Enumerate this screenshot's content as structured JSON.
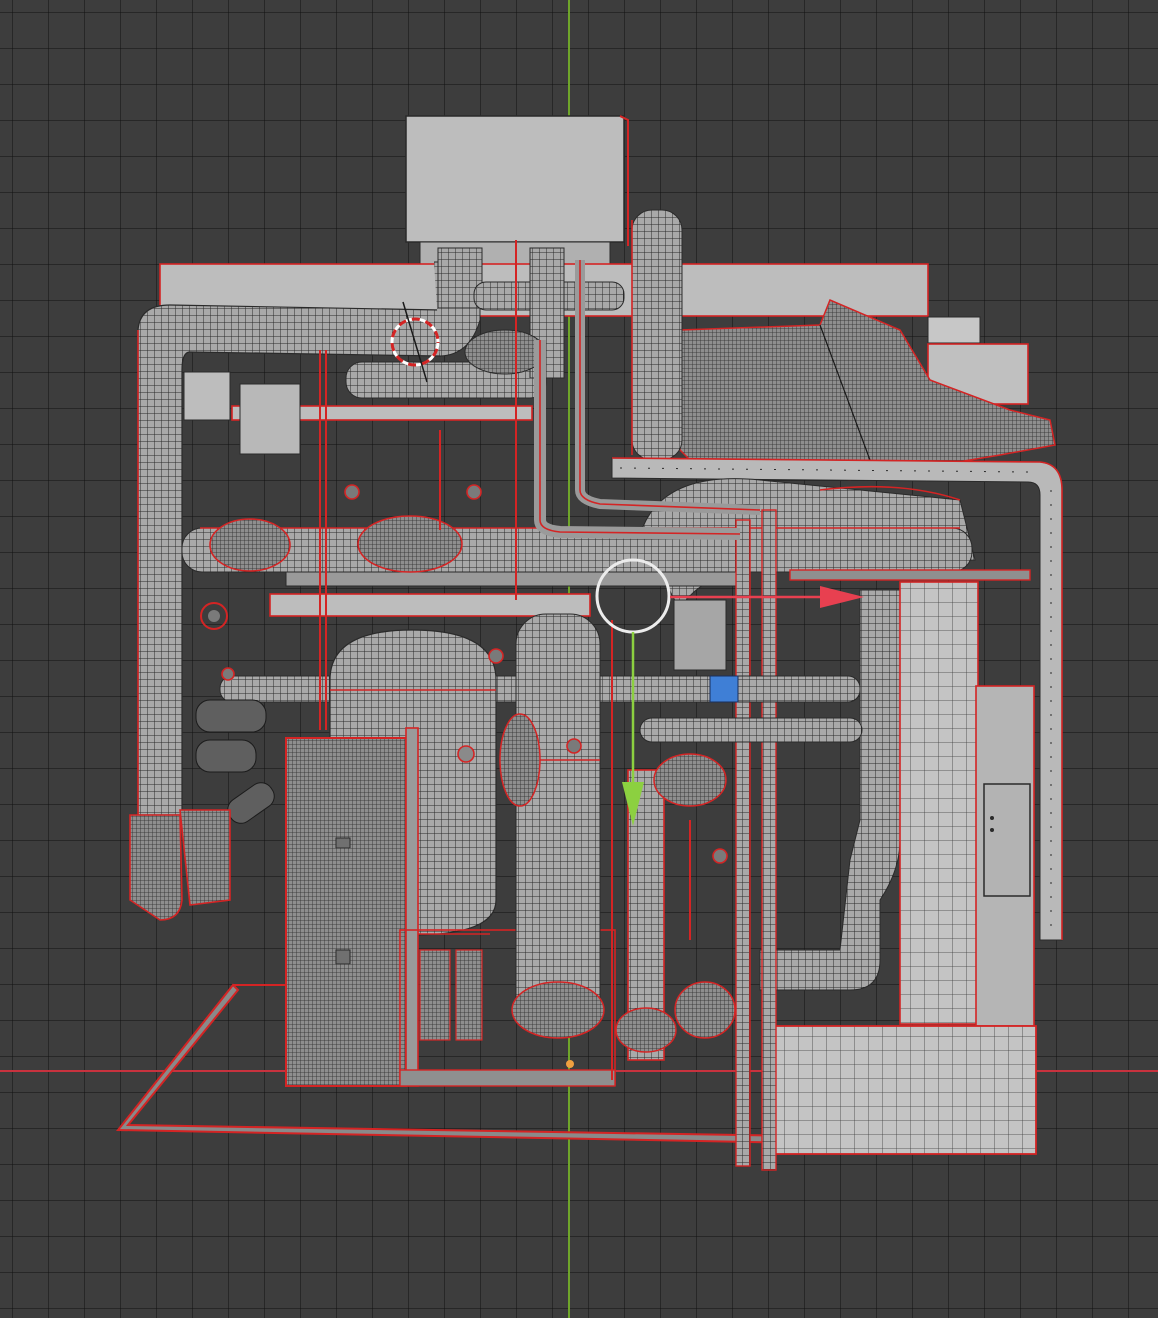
{
  "viewport": {
    "mode": "wireframe-overlay",
    "grid_visible": true,
    "selection_outline_color": "#d42424",
    "axes": {
      "x_axis_color": "#c8323e",
      "y_axis_color": "#6fa52a"
    },
    "gizmo": {
      "x_arrow_color": "#e84050",
      "y_arrow_color": "#8cd040",
      "ring_color": "#ececec"
    },
    "cursor_3d": {
      "icon": "3d-cursor-icon"
    },
    "selected_element_color": "#3f7fd6"
  }
}
